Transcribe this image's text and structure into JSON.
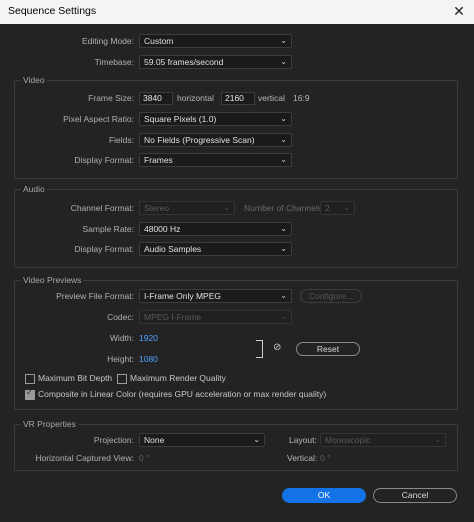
{
  "window": {
    "title": "Sequence Settings"
  },
  "top": {
    "editing_mode": {
      "label": "Editing Mode:",
      "value": "Custom"
    },
    "timebase": {
      "label": "Timebase:",
      "value": "59.05  frames/second"
    }
  },
  "video": {
    "section_label": "Video",
    "frame_size": {
      "label": "Frame Size:",
      "horizontal_value": "3840",
      "horizontal_label": "horizontal",
      "vertical_value": "2160",
      "vertical_label": "vertical",
      "ratio": "16:9"
    },
    "pixel_aspect_ratio": {
      "label": "Pixel Aspect Ratio:",
      "value": "Square Pixels (1.0)"
    },
    "fields": {
      "label": "Fields:",
      "value": "No Fields (Progressive Scan)"
    },
    "display_format": {
      "label": "Display Format:",
      "value": "Frames"
    }
  },
  "audio": {
    "section_label": "Audio",
    "channel_format": {
      "label": "Channel Format:",
      "value": "Stereo"
    },
    "number_of_channels": {
      "label": "Number of Channels:",
      "value": "2"
    },
    "sample_rate": {
      "label": "Sample Rate:",
      "value": "48000 Hz"
    },
    "display_format": {
      "label": "Display Format:",
      "value": "Audio Samples"
    }
  },
  "video_previews": {
    "section_label": "Video Previews",
    "preview_file_format": {
      "label": "Preview File Format:",
      "value": "I-Frame Only MPEG"
    },
    "configure_button": "Configure...",
    "codec": {
      "label": "Codec:",
      "value": "MPEG I-Frame"
    },
    "width": {
      "label": "Width:",
      "value": "1920"
    },
    "height": {
      "label": "Height:",
      "value": "1080"
    },
    "reset_button": "Reset",
    "max_bit_depth": {
      "label": "Maximum Bit Depth",
      "checked": false
    },
    "max_render_quality": {
      "label": "Maximum Render Quality",
      "checked": false
    },
    "composite_linear": {
      "label": "Composite in Linear Color (requires GPU acceleration or max render quality)",
      "checked": true
    }
  },
  "vr": {
    "section_label": "VR Properties",
    "projection": {
      "label": "Projection:",
      "value": "None"
    },
    "layout": {
      "label": "Layout:",
      "value": "Monoscopic"
    },
    "horizontal_captured_view": {
      "label": "Horizontal Captured View:",
      "value": "0 °"
    },
    "vertical": {
      "label": "Vertical:",
      "value": "0 °"
    }
  },
  "footer": {
    "ok_button": "OK",
    "cancel_button": "Cancel"
  },
  "colors": {
    "accent": "#1473e6",
    "link_value": "#4ea3ff",
    "dialog_bg": "#232323",
    "titlebar_bg": "#f4f4f4"
  }
}
